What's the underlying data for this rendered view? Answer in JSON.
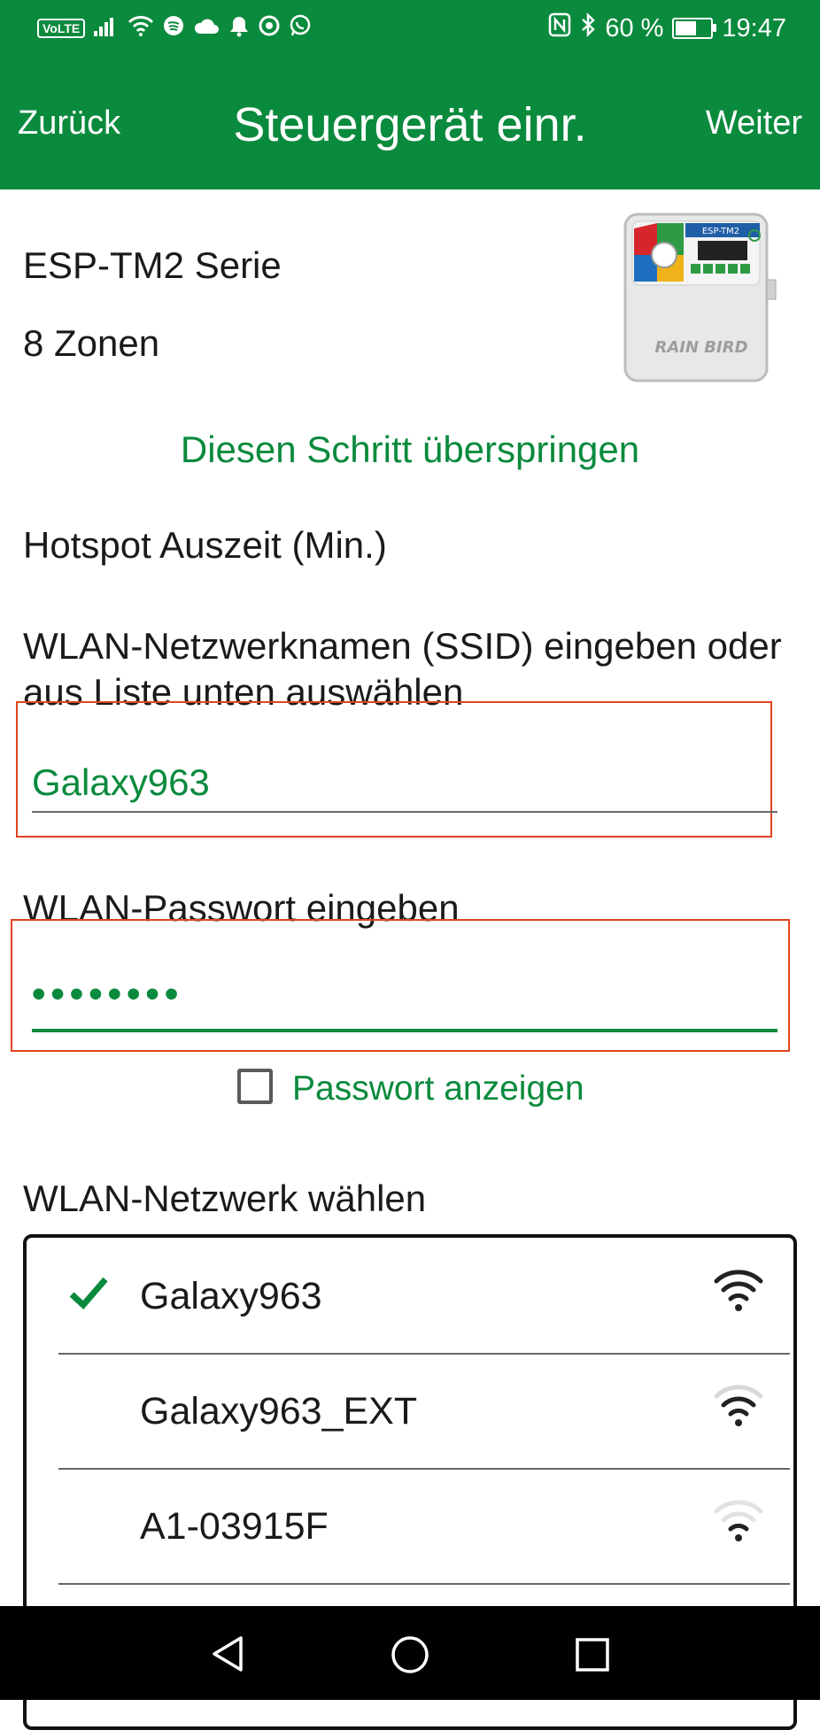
{
  "status_bar": {
    "volte": "VoLTE",
    "battery_percent": "60 %",
    "time": "19:47",
    "battery_level": 0.6,
    "icons_left": [
      "volte-icon",
      "signal-icon",
      "wifi-icon",
      "spotify-icon",
      "cloud-icon",
      "alarm-icon",
      "chrome-icon",
      "whatsapp-icon"
    ],
    "icons_right": [
      "nfc-icon",
      "bluetooth-icon",
      "battery-icon"
    ]
  },
  "header": {
    "back_label": "Zurück",
    "title": "Steuergerät einr.",
    "next_label": "Weiter"
  },
  "controller": {
    "model": "ESP-TM2 Serie",
    "zones": "8 Zonen",
    "image_brand": "RAIN BIRD",
    "image_model": "ESP-TM2"
  },
  "skip_link": "Diesen Schritt überspringen",
  "hotspot_label": "Hotspot Auszeit (Min.)",
  "ssid": {
    "label": "WLAN-Netzwerknamen (SSID) eingeben oder aus Liste unten auswählen",
    "value": "Galaxy963"
  },
  "password": {
    "label": "WLAN-Passwort eingeben",
    "value": "••••••••",
    "show_label": "Passwort anzeigen"
  },
  "network_section_label": "WLAN-Netzwerk wählen",
  "networks": [
    {
      "name": "Galaxy963",
      "selected": true,
      "signal": 4
    },
    {
      "name": "Galaxy963_EXT",
      "selected": false,
      "signal": 3
    },
    {
      "name": "A1-03915F",
      "selected": false,
      "signal": 1
    }
  ],
  "colors": {
    "brand_green": "#0a8a3d",
    "highlight_red": "#e0441f"
  }
}
